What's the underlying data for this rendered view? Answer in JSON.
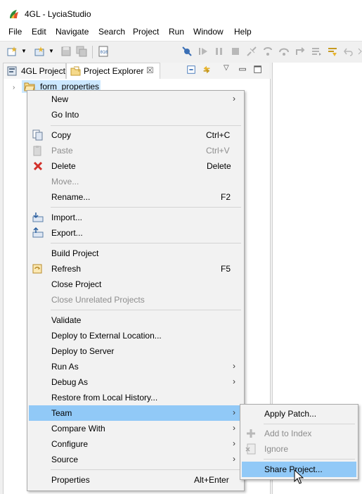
{
  "window": {
    "title": "4GL - LyciaStudio"
  },
  "menubar": [
    "File",
    "Edit",
    "Navigate",
    "Search",
    "Project",
    "Run",
    "Window",
    "Help"
  ],
  "tabs": [
    {
      "label": "4GL Project",
      "icon": "4gl-project-icon",
      "active": false
    },
    {
      "label": "Project Explorer",
      "icon": "project-explorer-icon",
      "active": true,
      "close": "☒"
    }
  ],
  "tree": {
    "item_label": "form_properties",
    "expand_glyph": "›"
  },
  "context_menu": {
    "items": [
      {
        "label": "New",
        "submenu": true
      },
      {
        "label": "Go Into"
      },
      {
        "label": "Copy",
        "shortcut": "Ctrl+C",
        "icon": "copy-icon"
      },
      {
        "label": "Paste",
        "shortcut": "Ctrl+V",
        "icon": "paste-icon",
        "disabled": true
      },
      {
        "label": "Delete",
        "shortcut": "Delete",
        "icon": "delete-icon"
      },
      {
        "label": "Move...",
        "disabled": true
      },
      {
        "label": "Rename...",
        "shortcut": "F2"
      },
      {
        "label": "Import...",
        "icon": "import-icon"
      },
      {
        "label": "Export...",
        "icon": "export-icon"
      },
      {
        "label": "Build Project"
      },
      {
        "label": "Refresh",
        "shortcut": "F5",
        "icon": "refresh-icon"
      },
      {
        "label": "Close Project"
      },
      {
        "label": "Close Unrelated Projects",
        "disabled": true
      },
      {
        "label": "Validate"
      },
      {
        "label": "Deploy to External Location..."
      },
      {
        "label": "Deploy to Server"
      },
      {
        "label": "Run As",
        "submenu": true
      },
      {
        "label": "Debug As",
        "submenu": true
      },
      {
        "label": "Restore from Local History..."
      },
      {
        "label": "Team",
        "submenu": true,
        "highlighted": true
      },
      {
        "label": "Compare With",
        "submenu": true
      },
      {
        "label": "Configure",
        "submenu": true
      },
      {
        "label": "Source",
        "submenu": true
      },
      {
        "label": "Properties",
        "shortcut": "Alt+Enter"
      }
    ],
    "submenu_arrow": "›"
  },
  "team_submenu": {
    "items": [
      {
        "label": "Apply Patch..."
      },
      {
        "label": "Add to Index",
        "disabled": true,
        "icon": "add-to-index-icon"
      },
      {
        "label": "Ignore",
        "disabled": true,
        "icon": "ignore-icon"
      },
      {
        "label": "Share Project...",
        "highlighted": true
      }
    ]
  },
  "colors": {
    "highlight": "#91c9f7",
    "menu_bg": "#f2f2f2",
    "disabled_text": "#8d8d8d",
    "selection": "#cce8ff"
  }
}
